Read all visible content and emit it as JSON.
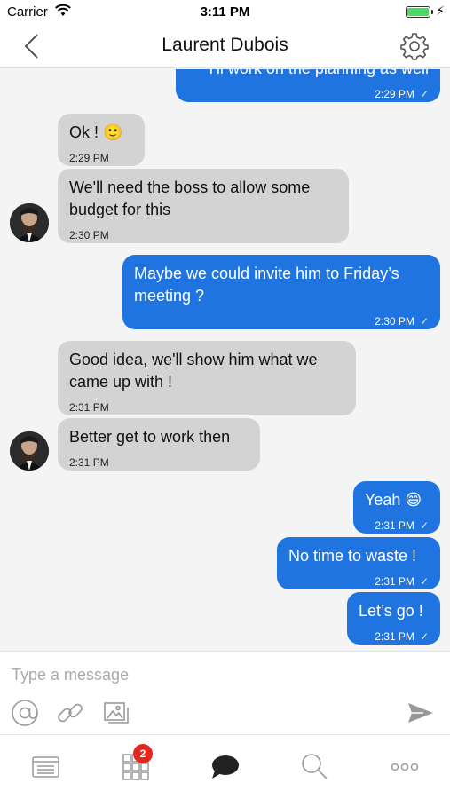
{
  "status_bar": {
    "carrier": "Carrier",
    "time": "3:11 PM"
  },
  "header": {
    "title": "Laurent Dubois"
  },
  "messages": [
    {
      "direction": "out",
      "text": "I'll work on the planning as well",
      "time": "2:29 PM",
      "read": "✓"
    },
    {
      "direction": "in",
      "text": "Ok ! 🙂",
      "time": "2:29 PM"
    },
    {
      "direction": "in",
      "text": "We'll need the boss to allow some budget for this",
      "time": "2:30 PM"
    },
    {
      "direction": "out",
      "text": "Maybe we could invite him to Friday’s meeting ?",
      "time": "2:30 PM",
      "read": "✓"
    },
    {
      "direction": "in",
      "text": "Good idea, we'll show him what we came up with !",
      "time": "2:31 PM"
    },
    {
      "direction": "in",
      "text": "Better get to work then",
      "time": "2:31 PM"
    },
    {
      "direction": "out",
      "text": "Yeah 😄",
      "time": "2:31 PM",
      "read": "✓"
    },
    {
      "direction": "out",
      "text": "No time to waste !",
      "time": "2:31 PM",
      "read": "✓"
    },
    {
      "direction": "out",
      "text": "Let’s go !",
      "time": "2:31 PM",
      "read": "✓"
    }
  ],
  "composer": {
    "placeholder": "Type a message",
    "icons": [
      "at-icon",
      "link-icon",
      "image-icon",
      "send-icon"
    ]
  },
  "tabbar": {
    "tabs": [
      "feed-tab",
      "apps-tab",
      "chat-tab",
      "search-tab",
      "more-tab"
    ],
    "apps_badge": "2",
    "active": "chat-tab"
  },
  "colors": {
    "outgoing": "#1f74e0",
    "incoming": "#d3d3d3",
    "badge": "#e8251c",
    "battery": "#4cd964"
  }
}
